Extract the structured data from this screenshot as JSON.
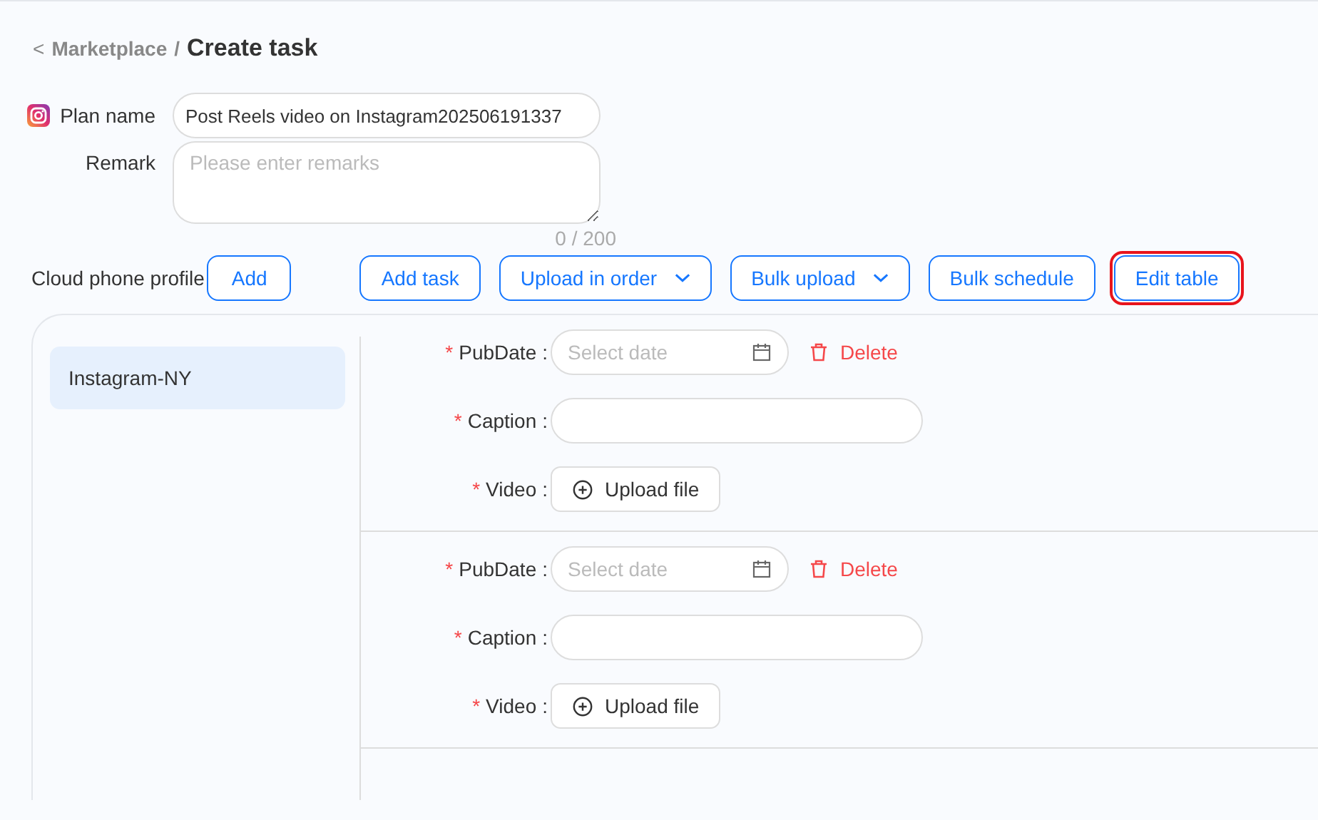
{
  "breadcrumb": {
    "back": "<",
    "parent": "Marketplace",
    "separator": "/",
    "current": "Create task"
  },
  "plan_name": {
    "label": "Plan name",
    "value": "Post Reels video on Instagram202506191337"
  },
  "remark": {
    "label": "Remark",
    "placeholder": "Please enter remarks",
    "counter": "0 / 200"
  },
  "profile": {
    "label": "Cloud phone profile",
    "add_button": "Add"
  },
  "toolbar": [
    {
      "label": "Add task",
      "dropdown": false,
      "highlighted": false
    },
    {
      "label": "Upload in order",
      "dropdown": true,
      "highlighted": false
    },
    {
      "label": "Bulk upload",
      "dropdown": true,
      "highlighted": false
    },
    {
      "label": "Bulk schedule",
      "dropdown": false,
      "highlighted": false
    },
    {
      "label": "Edit table",
      "dropdown": false,
      "highlighted": true
    }
  ],
  "profiles": [
    {
      "name": "Instagram-NY",
      "selected": true
    }
  ],
  "tasks": [
    {
      "fields": [
        {
          "kind": "date",
          "mark": "*",
          "label": "PubDate",
          "colon": ":",
          "placeholder": "Select date",
          "delete": "Delete"
        },
        {
          "kind": "text",
          "mark": "*",
          "label": "Caption",
          "colon": ":"
        },
        {
          "kind": "upload",
          "mark": "*",
          "label": "Video",
          "colon": ":",
          "button": "Upload file"
        }
      ]
    },
    {
      "fields": [
        {
          "kind": "date",
          "mark": "*",
          "label": "PubDate",
          "colon": ":",
          "placeholder": "Select date",
          "delete": "Delete"
        },
        {
          "kind": "text",
          "mark": "*",
          "label": "Caption",
          "colon": ":"
        },
        {
          "kind": "upload",
          "mark": "*",
          "label": "Video",
          "colon": ":",
          "button": "Upload file"
        }
      ]
    }
  ]
}
